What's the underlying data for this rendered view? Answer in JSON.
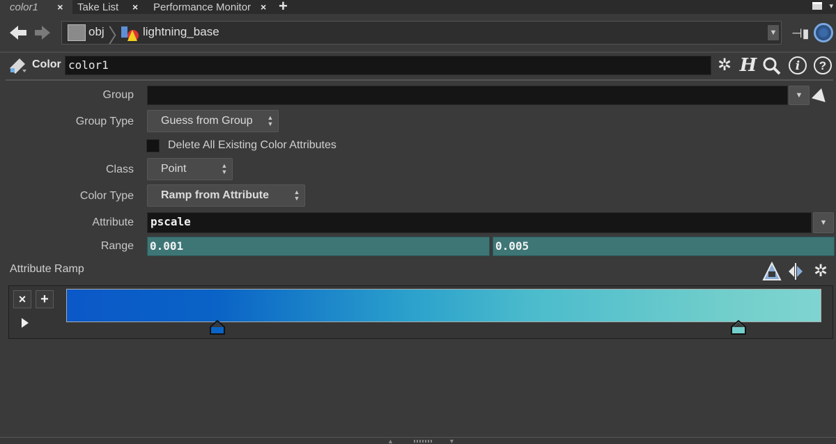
{
  "tabs": [
    {
      "label": "color1",
      "active": true
    },
    {
      "label": "Take List",
      "active": false
    },
    {
      "label": "Performance Monitor",
      "active": false
    }
  ],
  "tab_close_glyph": "×",
  "tab_add_glyph": "+",
  "path": {
    "root_label": "obj",
    "node_label": "lightning_base"
  },
  "node": {
    "type_label": "Color",
    "name_value": "color1",
    "header_icons": [
      "gear-icon",
      "houdini-h-icon",
      "search-icon",
      "info-icon",
      "help-icon"
    ]
  },
  "params": {
    "group": {
      "label": "Group",
      "value": ""
    },
    "group_type": {
      "label": "Group Type",
      "value": "Guess from Group"
    },
    "delete_attrs": {
      "label": "Delete All Existing Color Attributes",
      "checked": false
    },
    "class": {
      "label": "Class",
      "value": "Point"
    },
    "color_type": {
      "label": "Color Type",
      "value": "Ramp from Attribute"
    },
    "attribute": {
      "label": "Attribute",
      "value": "pscale"
    },
    "range": {
      "label": "Range",
      "min": "0.001",
      "max": "0.005"
    }
  },
  "ramp": {
    "label": "Attribute Ramp",
    "remove_glyph": "×",
    "add_glyph": "+",
    "keys": [
      {
        "position": 0.2,
        "color": "#0a63c6"
      },
      {
        "position": 0.89,
        "color": "#73cfcb"
      }
    ],
    "gradient_stops": [
      {
        "pos": 0.0,
        "color": "#0b58c8"
      },
      {
        "pos": 0.2,
        "color": "#0a63c6"
      },
      {
        "pos": 0.45,
        "color": "#2aa0cc"
      },
      {
        "pos": 0.62,
        "color": "#4cbccc"
      },
      {
        "pos": 0.89,
        "color": "#73cfcb"
      },
      {
        "pos": 1.0,
        "color": "#7fd4d0"
      }
    ]
  },
  "colors": {
    "range_field": "#3e7676",
    "panel_bg": "#3a3a3a"
  }
}
